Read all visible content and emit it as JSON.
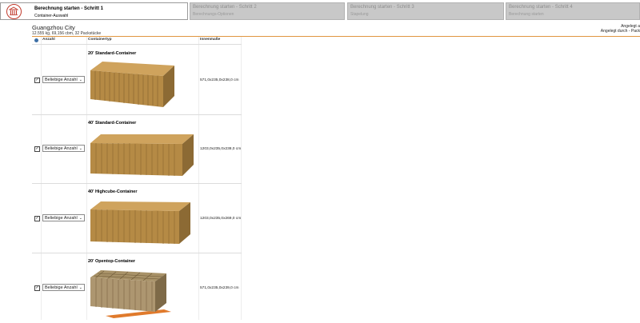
{
  "wizard": {
    "steps": [
      {
        "title": "Berechnung starten - Schritt 1",
        "subtitle": "Container-Auswahl"
      },
      {
        "title": "Berechnung starten - Schritt 2",
        "subtitle": "Berechnungs-Optionen"
      },
      {
        "title": "Berechnung starten - Schritt 3",
        "subtitle": "Stapelung"
      },
      {
        "title": "Berechnung starten - Schritt 4",
        "subtitle": "Berechnung starten"
      }
    ]
  },
  "header": {
    "location": "Guangzhou City",
    "summary": "12.555 kg, 69,156 cbm, 32 Packstücke",
    "right_note_1": "Angelegt a",
    "right_note_2": "Angelegt durch - Pack"
  },
  "table": {
    "columns": [
      "Anzahl",
      "Containertyp",
      "Innenmaße"
    ],
    "rows": [
      {
        "title": "20' Standard-Container",
        "dims": "571,0x235,0x238,0 cm",
        "quantity": "Beliebige Anzahl"
      },
      {
        "title": "40' Standard-Container",
        "dims": "1203,0x235,0x238,0 cm",
        "quantity": "Beliebige Anzahl"
      },
      {
        "title": "40' Highcube-Container",
        "dims": "1203,0x235,0x269,0 cm",
        "quantity": "Beliebige Anzahl"
      },
      {
        "title": "20' Opentop-Container",
        "dims": "571,0x235,0x239,0 cm",
        "quantity": "Beliebige Anzahl"
      }
    ]
  },
  "colors": {
    "accent": "#c0392b",
    "divider": "#e09640",
    "container": "#b58a45"
  },
  "icons": {
    "logo": "building-icon",
    "info": "info-icon",
    "dropdown": "chevron-down-icon"
  }
}
